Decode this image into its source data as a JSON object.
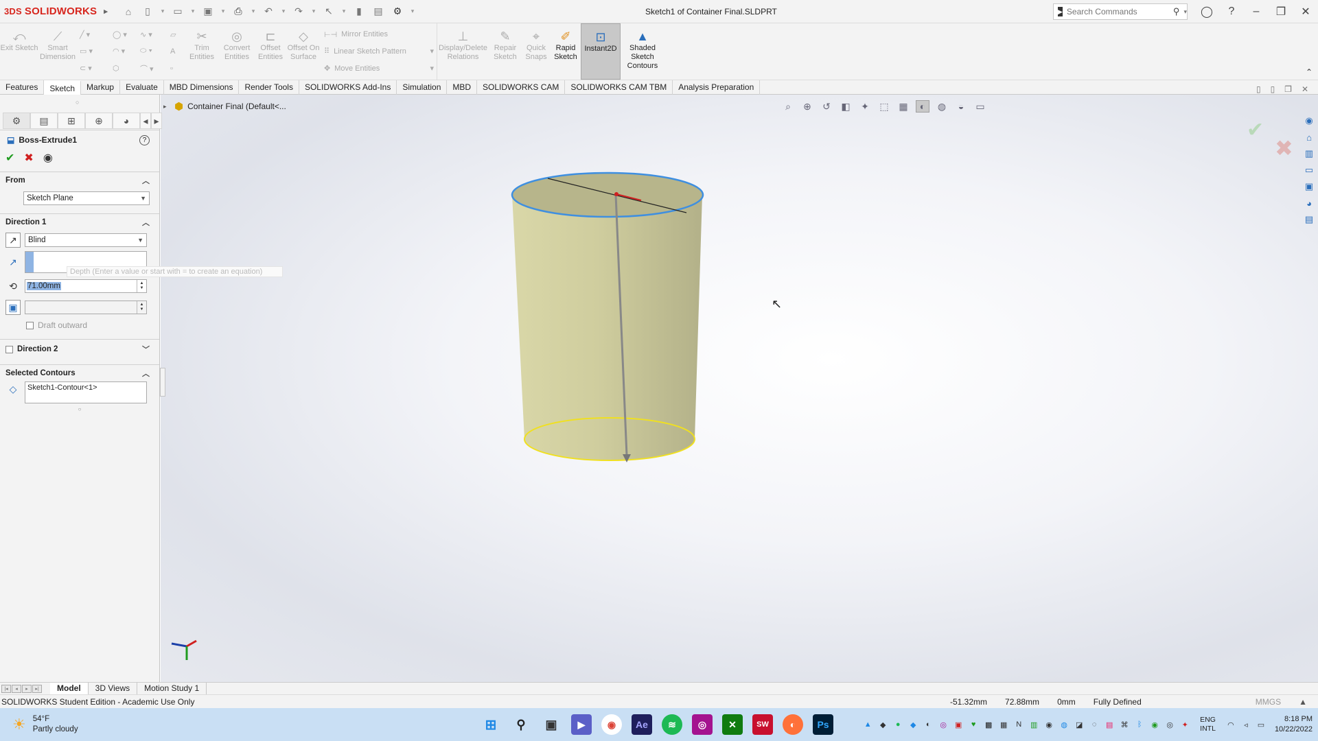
{
  "app": {
    "logo_prefix": "3DS",
    "logo_text": "SOLIDWORKS",
    "doc_title": "Sketch1 of Container Final.SLDPRT",
    "search_placeholder": "Search Commands"
  },
  "command_manager": {
    "exit_sketch": "Exit Sketch",
    "smart_dimension": "Smart Dimension",
    "trim_entities": "Trim Entities",
    "convert_entities": "Convert Entities",
    "offset_entities": "Offset Entities",
    "offset_on_surface": "Offset On Surface",
    "mirror_entities": "Mirror Entities",
    "linear_sketch_pattern": "Linear Sketch Pattern",
    "move_entities": "Move Entities",
    "display_delete_relations": "Display/Delete Relations",
    "repair_sketch": "Repair Sketch",
    "quick_snaps": "Quick Snaps",
    "rapid_sketch": "Rapid Sketch",
    "instant2d": "Instant2D",
    "shaded_sketch_contours": "Shaded Sketch Contours"
  },
  "tabs": [
    "Features",
    "Sketch",
    "Markup",
    "Evaluate",
    "MBD Dimensions",
    "Render Tools",
    "SOLIDWORKS Add-Ins",
    "Simulation",
    "MBD",
    "SOLIDWORKS CAM",
    "SOLIDWORKS CAM TBM",
    "Analysis Preparation"
  ],
  "property_manager": {
    "title": "Boss-Extrude1",
    "from_label": "From",
    "from_value": "Sketch Plane",
    "direction1_label": "Direction 1",
    "end_condition": "Blind",
    "depth_value": "71.00mm",
    "depth_tooltip": "Depth (Enter a value or start with = to create an equation)",
    "draft_outward": "Draft outward",
    "direction2_label": "Direction 2",
    "selected_contours_label": "Selected Contours",
    "contour_item": "Sketch1-Contour<1>"
  },
  "tree": {
    "root": "Container Final  (Default<..."
  },
  "bottom_tabs": [
    "Model",
    "3D Views",
    "Motion Study 1"
  ],
  "status": {
    "message": "SOLIDWORKS Student Edition - Academic Use Only",
    "x": "-51.32mm",
    "y": "72.88mm",
    "z": "0mm",
    "state": "Fully Defined",
    "units": "MMGS"
  },
  "taskbar": {
    "temp": "54°F",
    "weather": "Partly cloudy",
    "lang1": "ENG",
    "lang2": "INTL",
    "time": "8:18 PM",
    "date": "10/22/2022"
  },
  "colors": {
    "solid_fill": "#c9c79a",
    "top_edge": "#3f8fe0",
    "bottom_edge": "#f0e020",
    "accent": "#2a6ebb"
  }
}
